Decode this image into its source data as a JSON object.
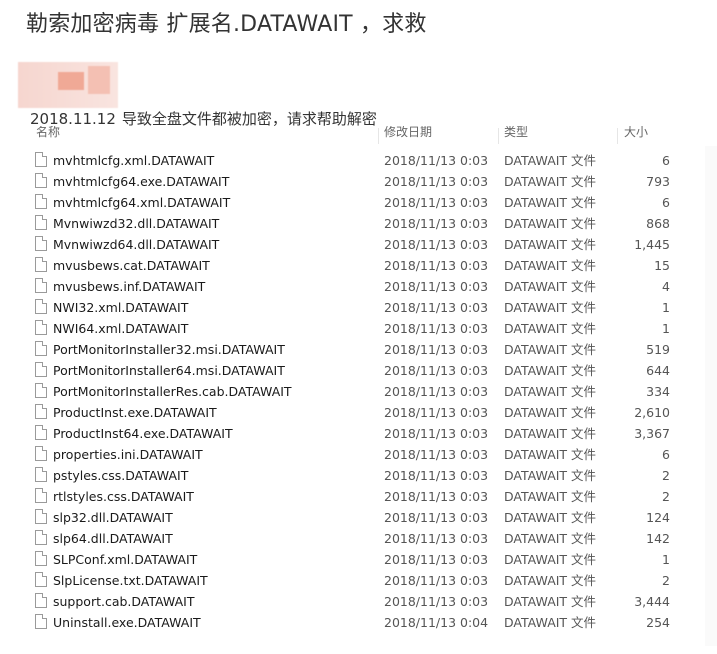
{
  "post": {
    "title": "勒索加密病毒 扩展名.DATAWAIT ，求救",
    "date": "2018.11.12",
    "description": "导致全盘文件都被加密，请求帮助解密"
  },
  "columns": {
    "name": "名称",
    "date": "修改日期",
    "type": "类型",
    "size": "大小"
  },
  "files": [
    {
      "name": "mvhtmlcfg.xml.DATAWAIT",
      "date": "2018/11/13 0:03",
      "type": "DATAWAIT 文件",
      "size": "6"
    },
    {
      "name": "mvhtmlcfg64.exe.DATAWAIT",
      "date": "2018/11/13 0:03",
      "type": "DATAWAIT 文件",
      "size": "793"
    },
    {
      "name": "mvhtmlcfg64.xml.DATAWAIT",
      "date": "2018/11/13 0:03",
      "type": "DATAWAIT 文件",
      "size": "6"
    },
    {
      "name": "Mvnwiwzd32.dll.DATAWAIT",
      "date": "2018/11/13 0:03",
      "type": "DATAWAIT 文件",
      "size": "868"
    },
    {
      "name": "Mvnwiwzd64.dll.DATAWAIT",
      "date": "2018/11/13 0:03",
      "type": "DATAWAIT 文件",
      "size": "1,445"
    },
    {
      "name": "mvusbews.cat.DATAWAIT",
      "date": "2018/11/13 0:03",
      "type": "DATAWAIT 文件",
      "size": "15"
    },
    {
      "name": "mvusbews.inf.DATAWAIT",
      "date": "2018/11/13 0:03",
      "type": "DATAWAIT 文件",
      "size": "4"
    },
    {
      "name": "NWI32.xml.DATAWAIT",
      "date": "2018/11/13 0:03",
      "type": "DATAWAIT 文件",
      "size": "1"
    },
    {
      "name": "NWI64.xml.DATAWAIT",
      "date": "2018/11/13 0:03",
      "type": "DATAWAIT 文件",
      "size": "1"
    },
    {
      "name": "PortMonitorInstaller32.msi.DATAWAIT",
      "date": "2018/11/13 0:03",
      "type": "DATAWAIT 文件",
      "size": "519"
    },
    {
      "name": "PortMonitorInstaller64.msi.DATAWAIT",
      "date": "2018/11/13 0:03",
      "type": "DATAWAIT 文件",
      "size": "644"
    },
    {
      "name": "PortMonitorInstallerRes.cab.DATAWAIT",
      "date": "2018/11/13 0:03",
      "type": "DATAWAIT 文件",
      "size": "334"
    },
    {
      "name": "ProductInst.exe.DATAWAIT",
      "date": "2018/11/13 0:03",
      "type": "DATAWAIT 文件",
      "size": "2,610"
    },
    {
      "name": "ProductInst64.exe.DATAWAIT",
      "date": "2018/11/13 0:03",
      "type": "DATAWAIT 文件",
      "size": "3,367"
    },
    {
      "name": "properties.ini.DATAWAIT",
      "date": "2018/11/13 0:03",
      "type": "DATAWAIT 文件",
      "size": "6"
    },
    {
      "name": "pstyles.css.DATAWAIT",
      "date": "2018/11/13 0:03",
      "type": "DATAWAIT 文件",
      "size": "2"
    },
    {
      "name": "rtlstyles.css.DATAWAIT",
      "date": "2018/11/13 0:03",
      "type": "DATAWAIT 文件",
      "size": "2"
    },
    {
      "name": "slp32.dll.DATAWAIT",
      "date": "2018/11/13 0:03",
      "type": "DATAWAIT 文件",
      "size": "124"
    },
    {
      "name": "slp64.dll.DATAWAIT",
      "date": "2018/11/13 0:03",
      "type": "DATAWAIT 文件",
      "size": "142"
    },
    {
      "name": "SLPConf.xml.DATAWAIT",
      "date": "2018/11/13 0:03",
      "type": "DATAWAIT 文件",
      "size": "1"
    },
    {
      "name": "SlpLicense.txt.DATAWAIT",
      "date": "2018/11/13 0:03",
      "type": "DATAWAIT 文件",
      "size": "2"
    },
    {
      "name": "support.cab.DATAWAIT",
      "date": "2018/11/13 0:03",
      "type": "DATAWAIT 文件",
      "size": "3,444"
    },
    {
      "name": "Uninstall.exe.DATAWAIT",
      "date": "2018/11/13 0:04",
      "type": "DATAWAIT 文件",
      "size": "254"
    }
  ]
}
